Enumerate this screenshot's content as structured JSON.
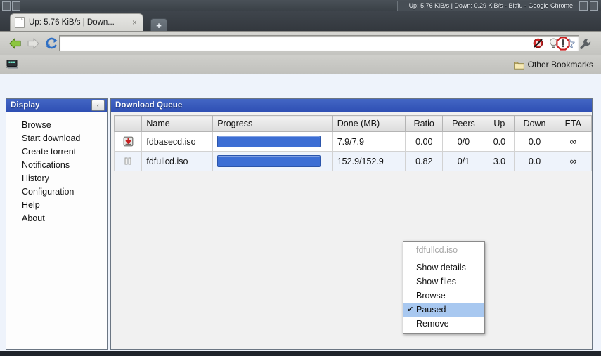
{
  "window": {
    "title": "Up: 5.76 KiB/s | Down: 0.29 KiB/s - Bitflu - Google Chrome"
  },
  "tabs": [
    {
      "title": "Up: 5.76 KiB/s | Down...",
      "close_label": "×",
      "favicon": "page-icon"
    }
  ],
  "newtab": {
    "label": "+"
  },
  "toolbar": {
    "back": "back-arrow-icon",
    "forward": "forward-arrow-icon",
    "reload": "reload-icon",
    "address_value": "",
    "address_placeholder": "",
    "omnibox_icons": [
      "blocked-popup-icon",
      "lightbulb-icon",
      "star-bookmark-icon"
    ],
    "extension": "adblock-stop-icon",
    "menu": "wrench-icon"
  },
  "bookmarks": {
    "app_icon": "apps-icon",
    "other_label": "Other Bookmarks",
    "other_icon": "folder-icon"
  },
  "sidebar": {
    "header": "Display",
    "collapse_label": "‹",
    "items": [
      {
        "label": "Browse"
      },
      {
        "label": "Start download"
      },
      {
        "label": "Create torrent"
      },
      {
        "label": "Notifications"
      },
      {
        "label": "History"
      },
      {
        "label": "Configuration"
      },
      {
        "label": "Help"
      },
      {
        "label": "About"
      }
    ]
  },
  "queue": {
    "header": "Download Queue",
    "columns": [
      "",
      "Name",
      "Progress",
      "Done (MB)",
      "Ratio",
      "Peers",
      "Up",
      "Down",
      "ETA"
    ],
    "rows": [
      {
        "status_icon": "download-icon",
        "name": "fdbasecd.iso",
        "progress_percent": 100,
        "done": "7.9/7.9",
        "ratio": "0.00",
        "peers": "0/0",
        "up": "0.0",
        "down": "0.0",
        "eta": "∞"
      },
      {
        "status_icon": "pause-icon",
        "name": "fdfullcd.iso",
        "progress_percent": 100,
        "done": "152.9/152.9",
        "ratio": "0.82",
        "peers": "0/1",
        "up": "3.0",
        "down": "0.0",
        "eta": "∞"
      }
    ]
  },
  "context_menu": {
    "title": "fdfullcd.iso",
    "items": [
      {
        "label": "Show details",
        "checked": false,
        "selected": false
      },
      {
        "label": "Show files",
        "checked": false,
        "selected": false
      },
      {
        "label": "Browse",
        "checked": false,
        "selected": false
      },
      {
        "label": "Paused",
        "checked": true,
        "selected": true
      },
      {
        "label": "Remove",
        "checked": false,
        "selected": false
      }
    ],
    "check_glyph": "✔"
  },
  "colors": {
    "panel_header_blue": "#2f50b4",
    "progress_blue": "#3c6ed4",
    "alt_row": "#eef3fb",
    "menu_highlight": "#a8c8f0"
  }
}
